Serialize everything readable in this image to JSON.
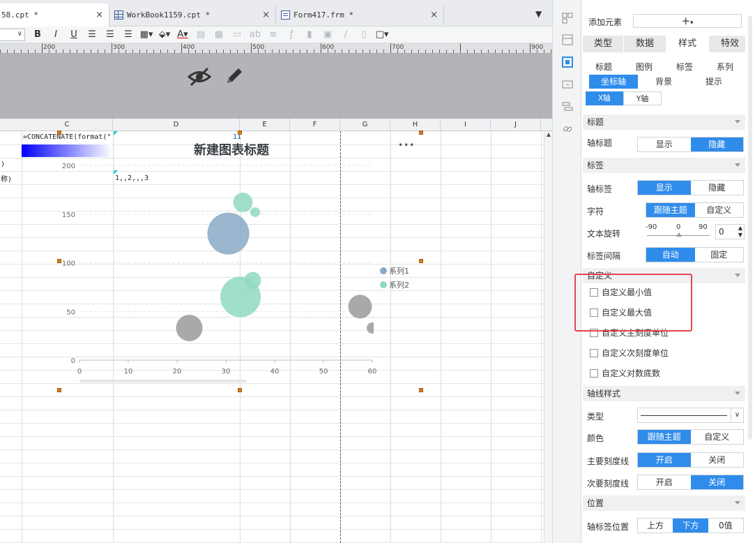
{
  "tabs": [
    {
      "label": "58.cpt *",
      "close": "×",
      "icon": "none"
    },
    {
      "label": "WorkBook1159.cpt *",
      "close": "×",
      "icon": "grid-file-icon"
    },
    {
      "label": "Form417.frm *",
      "close": "×",
      "icon": "form-file-icon"
    }
  ],
  "toolbar": {
    "bold": "B",
    "italic": "I",
    "underline": "U"
  },
  "ruler": {
    "labels": [
      "200",
      "300",
      "400",
      "500",
      "600",
      "700",
      "900"
    ]
  },
  "sheet": {
    "columns": [
      "C",
      "D",
      "E",
      "F",
      "G",
      "H",
      "I",
      "J"
    ],
    "cells": {
      "formula": "=CONCATENATE(format(\"",
      "e_marker": "11",
      "left1": ")",
      "left2": "称)",
      "seq": "1,,2,,,3"
    }
  },
  "chart_data": {
    "type": "scatter",
    "title": "新建图表标题",
    "more": "•••",
    "xlim": [
      0,
      60
    ],
    "ylim": [
      0,
      200
    ],
    "x_ticks": [
      0,
      10,
      20,
      30,
      40,
      50,
      60
    ],
    "y_ticks": [
      0,
      50,
      100,
      150,
      200
    ],
    "legend_placement": "right",
    "series": [
      {
        "name": "系列1",
        "color": "#8aa9c6",
        "points": [
          {
            "x": 30.5,
            "y": 130,
            "r": 30
          },
          {
            "x": 22.5,
            "y": 33,
            "r": 19
          },
          {
            "x": 57.5,
            "y": 55,
            "r": 17
          },
          {
            "x": 60,
            "y": 33,
            "r": 8
          }
        ]
      },
      {
        "name": "系列2",
        "color": "#8fd9c1",
        "points": [
          {
            "x": 33,
            "y": 65,
            "r": 29
          },
          {
            "x": 35.5,
            "y": 82,
            "r": 12
          },
          {
            "x": 33.5,
            "y": 162,
            "r": 14
          },
          {
            "x": 36,
            "y": 152,
            "r": 7
          }
        ]
      }
    ],
    "gray_bubble_color": "#9a9a9a"
  },
  "panel": {
    "add_element_label": "添加元素",
    "add_element_value": "+",
    "main_tabs": [
      "类型",
      "数据",
      "样式",
      "特效"
    ],
    "sub_tabs_row1": [
      "标题",
      "图例",
      "标签",
      "系列"
    ],
    "sub_tabs_row2": [
      "坐标轴",
      "背景",
      "提示"
    ],
    "axis_tabs": [
      "X轴",
      "Y轴"
    ],
    "sections": {
      "title": "标题",
      "label": "标签",
      "custom": "自定义",
      "axis_style": "轴线样式",
      "position": "位置"
    },
    "axis_title": {
      "label": "轴标题",
      "options": [
        "显示",
        "隐藏"
      ]
    },
    "axis_label": {
      "label": "轴标签",
      "options": [
        "显示",
        "隐藏"
      ]
    },
    "charset": {
      "label": "字符",
      "options": [
        "跟随主题",
        "自定义"
      ]
    },
    "rotation": {
      "label": "文本旋转",
      "min": "-90",
      "mid": "0",
      "max": "90",
      "value": "0"
    },
    "interval": {
      "label": "标签间隔",
      "options": [
        "自动",
        "固定"
      ]
    },
    "custom_checks": [
      "自定义最小值",
      "自定义最大值",
      "自定义主刻度单位",
      "自定义次刻度单位",
      "自定义对数底数"
    ],
    "line_type": {
      "label": "类型"
    },
    "line_color": {
      "label": "颜色",
      "options": [
        "跟随主题",
        "自定义"
      ]
    },
    "major_tick": {
      "label": "主要刻度线",
      "options": [
        "开启",
        "关闭"
      ]
    },
    "minor_tick": {
      "label": "次要刻度线",
      "options": [
        "开启",
        "关闭"
      ]
    },
    "label_pos": {
      "label": "轴标签位置",
      "options": [
        "上方",
        "下方",
        "0值"
      ]
    }
  }
}
